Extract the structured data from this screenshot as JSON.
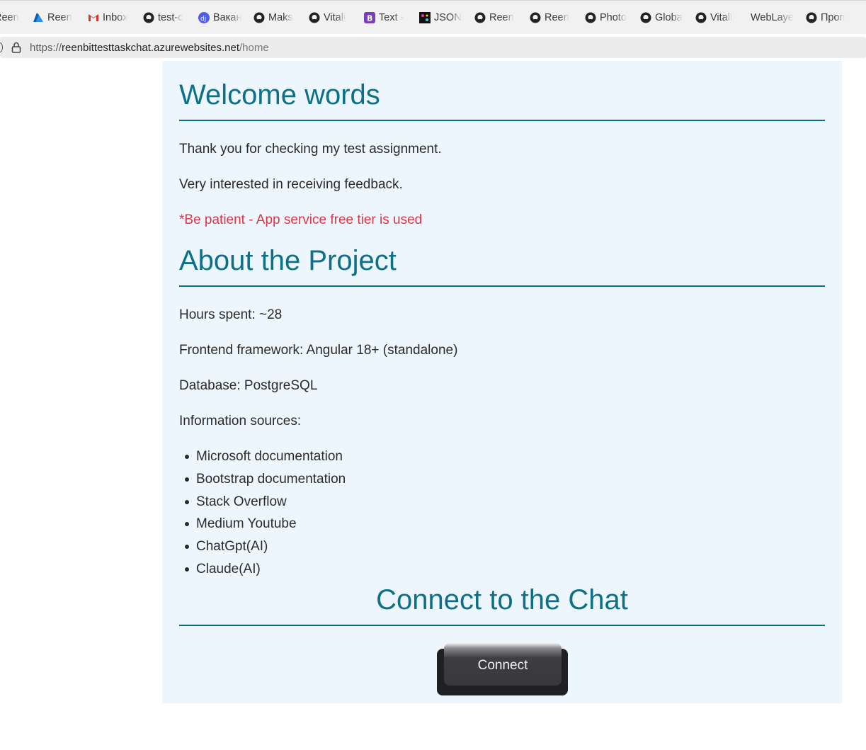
{
  "browser": {
    "bookmarks": [
      {
        "label": "Reen",
        "icon": "globe-icon",
        "color": "#555555"
      },
      {
        "label": "Reen",
        "icon": "azure-icon",
        "color": "#0078d4"
      },
      {
        "label": "Inbox",
        "icon": "gmail-icon",
        "color": "#d93025"
      },
      {
        "label": "test-c",
        "icon": "github-icon",
        "color": "#222222"
      },
      {
        "label": "Вакан",
        "icon": "djinni-icon",
        "color": "#4f5cf0"
      },
      {
        "label": "Maks",
        "icon": "github-icon",
        "color": "#222222"
      },
      {
        "label": "Vitali",
        "icon": "github-icon",
        "color": "#222222"
      },
      {
        "label": "Text -",
        "icon": "bootstrap-icon",
        "color": "#7a3fb8"
      },
      {
        "label": "JSON",
        "icon": "json-icon",
        "color": "#111111"
      },
      {
        "label": "Reen",
        "icon": "github-icon",
        "color": "#222222"
      },
      {
        "label": "Reen",
        "icon": "github-icon",
        "color": "#222222"
      },
      {
        "label": "Photo",
        "icon": "github-icon",
        "color": "#222222"
      },
      {
        "label": "Globa",
        "icon": "github-icon",
        "color": "#222222"
      },
      {
        "label": "Vitali",
        "icon": "github-icon",
        "color": "#222222"
      },
      {
        "label": "WebLaye",
        "icon": "",
        "color": "#222222"
      },
      {
        "label": "Проп",
        "icon": "github-icon",
        "color": "#222222"
      }
    ],
    "url": {
      "scheme": "https://",
      "host": "reenbittesttaskchat.azurewebsites.net",
      "path": "/home"
    }
  },
  "welcome": {
    "title": "Welcome words",
    "line1": "Thank you for checking my test assignment.",
    "line2": "Very interested in receiving feedback.",
    "warning": "*Be patient - App service free tier is used"
  },
  "about": {
    "title": "About the Project",
    "hours": "Hours spent: ~28",
    "framework": "Frontend framework: Angular 18+ (standalone)",
    "database": "Database: PostgreSQL",
    "sources_label": "Information sources:",
    "sources": [
      "Microsoft documentation",
      "Bootstrap documentation",
      "Stack Overflow",
      "Medium Youtube",
      "ChatGpt(AI)",
      "Claude(AI)"
    ]
  },
  "chat": {
    "title": "Connect to the Chat",
    "connect_label": "Connect"
  },
  "colors": {
    "heading": "#0d7087",
    "rule": "#0c6e7c",
    "warning": "#dc3545",
    "panel_bg": "#eef6fd",
    "button_bg": "#202023"
  }
}
